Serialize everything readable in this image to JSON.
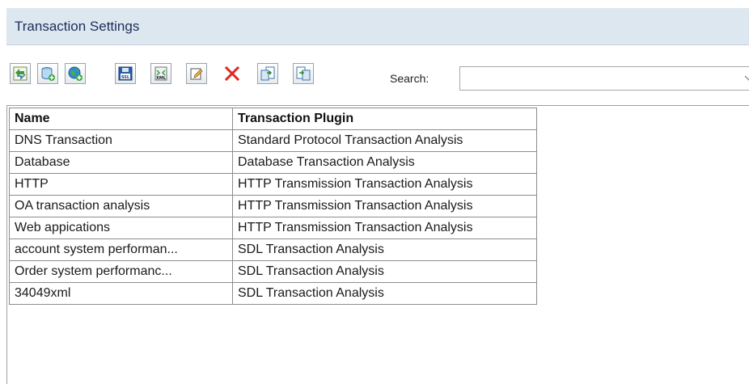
{
  "header": {
    "title": "Transaction Settings"
  },
  "toolbar": {
    "buttons": [
      {
        "icon": "add-transaction-icon"
      },
      {
        "icon": "add-database-icon"
      },
      {
        "icon": "add-web-icon"
      },
      {
        "icon": "ssl-icon"
      },
      {
        "icon": "xml-icon"
      },
      {
        "icon": "edit-icon"
      },
      {
        "icon": "delete-icon"
      },
      {
        "icon": "import-icon"
      },
      {
        "icon": "export-icon"
      }
    ],
    "search_label": "Search:",
    "search_value": ""
  },
  "table": {
    "columns": [
      "Name",
      "Transaction Plugin"
    ],
    "rows": [
      [
        "DNS Transaction",
        "Standard Protocol Transaction Analysis"
      ],
      [
        "Database",
        "Database Transaction Analysis"
      ],
      [
        "HTTP",
        "HTTP Transmission Transaction Analysis"
      ],
      [
        "OA transaction analysis",
        "HTTP Transmission Transaction Analysis"
      ],
      [
        "Web appications",
        "HTTP Transmission Transaction Analysis"
      ],
      [
        "account system performan...",
        "SDL Transaction Analysis"
      ],
      [
        "Order system performanc...",
        "SDL Transaction Analysis"
      ],
      [
        "34049xml",
        "SDL Transaction Analysis"
      ]
    ]
  },
  "colors": {
    "title_bar_bg": "#dde7f0",
    "title_text": "#1b2f5a",
    "delete_red": "#e0281f"
  }
}
